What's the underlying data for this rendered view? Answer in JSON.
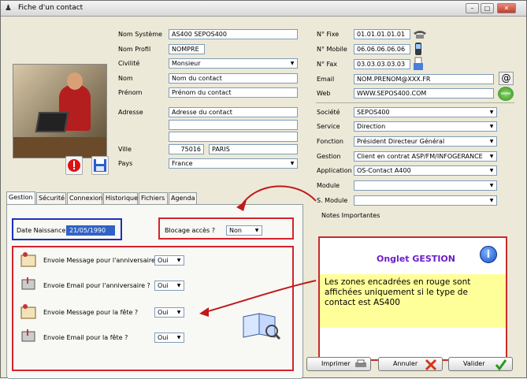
{
  "window": {
    "title": "Fiche d'un contact",
    "app_icon": "app-icon"
  },
  "identity": {
    "nom_systeme": {
      "label": "Nom Système",
      "value": "AS400 SEPOS400"
    },
    "nom_profil": {
      "label": "Nom Profil",
      "value": "NOMPRE"
    },
    "civilite": {
      "label": "Civilité",
      "value": "Monsieur"
    },
    "nom": {
      "label": "Nom",
      "value": "Nom du contact"
    },
    "prenom": {
      "label": "Prénom",
      "value": "Prénom du contact"
    },
    "adresse": {
      "label": "Adresse",
      "line1": "Adresse du contact",
      "line2": "",
      "line3": ""
    },
    "ville": {
      "label": "Ville",
      "cp": "75016",
      "value": "PARIS"
    },
    "pays": {
      "label": "Pays",
      "value": "France"
    }
  },
  "contact": {
    "fixe": {
      "label": "N° Fixe",
      "value": "01.01.01.01.01"
    },
    "mobile": {
      "label": "N° Mobile",
      "value": "06.06.06.06.06"
    },
    "fax": {
      "label": "N° Fax",
      "value": "03.03.03.03.03"
    },
    "email": {
      "label": "Email",
      "value": "NOM.PRENOM@XXX.FR"
    },
    "web": {
      "label": "Web",
      "value": "WWW.SEPOS400.COM"
    }
  },
  "company": {
    "societe": {
      "label": "Société",
      "value": "SEPOS400"
    },
    "service": {
      "label": "Service",
      "value": "Direction"
    },
    "fonction": {
      "label": "Fonction",
      "value": "Président Directeur Général"
    },
    "gestion": {
      "label": "Gestion",
      "value": "Client en contrat ASP/FM/INFOGERANCE"
    },
    "application": {
      "label": "Application",
      "value": "OS-Contact A400"
    },
    "module": {
      "label": "Module",
      "value": ""
    },
    "smodule": {
      "label": "S. Module",
      "value": ""
    }
  },
  "tabs": [
    "Gestion",
    "Sécurité",
    "Connexion",
    "Historique",
    "Fichiers",
    "Agenda"
  ],
  "gestion": {
    "date_naissance": {
      "label": "Date Naissance",
      "value": "21/05/1990"
    },
    "blocage": {
      "label": "Blocage accès ?",
      "value": "Non"
    },
    "options": [
      {
        "label": "Envoie Message pour l'anniversaire ?",
        "value": "Oui"
      },
      {
        "label": "Envoie Email pour l'anniversaire ?",
        "value": "Oui"
      },
      {
        "label": "Envoie Message pour la fête ?",
        "value": "Oui"
      },
      {
        "label": "Envoie Email pour la fête ?",
        "value": "Oui"
      }
    ]
  },
  "notes": {
    "label": "Notes Importantes",
    "title": "Onglet GESTION",
    "text": "Les zones encadrées en rouge sont affichées uniquement si le type de contact est AS400"
  },
  "buttons": {
    "imprimer": "Imprimer",
    "annuler": "Annuler",
    "valider": "Valider"
  },
  "colors": {
    "highlight": "#d3232d",
    "blue_box": "#1d2fbf",
    "note_yellow": "#ffff9a",
    "note_title": "#6a1fc9"
  }
}
